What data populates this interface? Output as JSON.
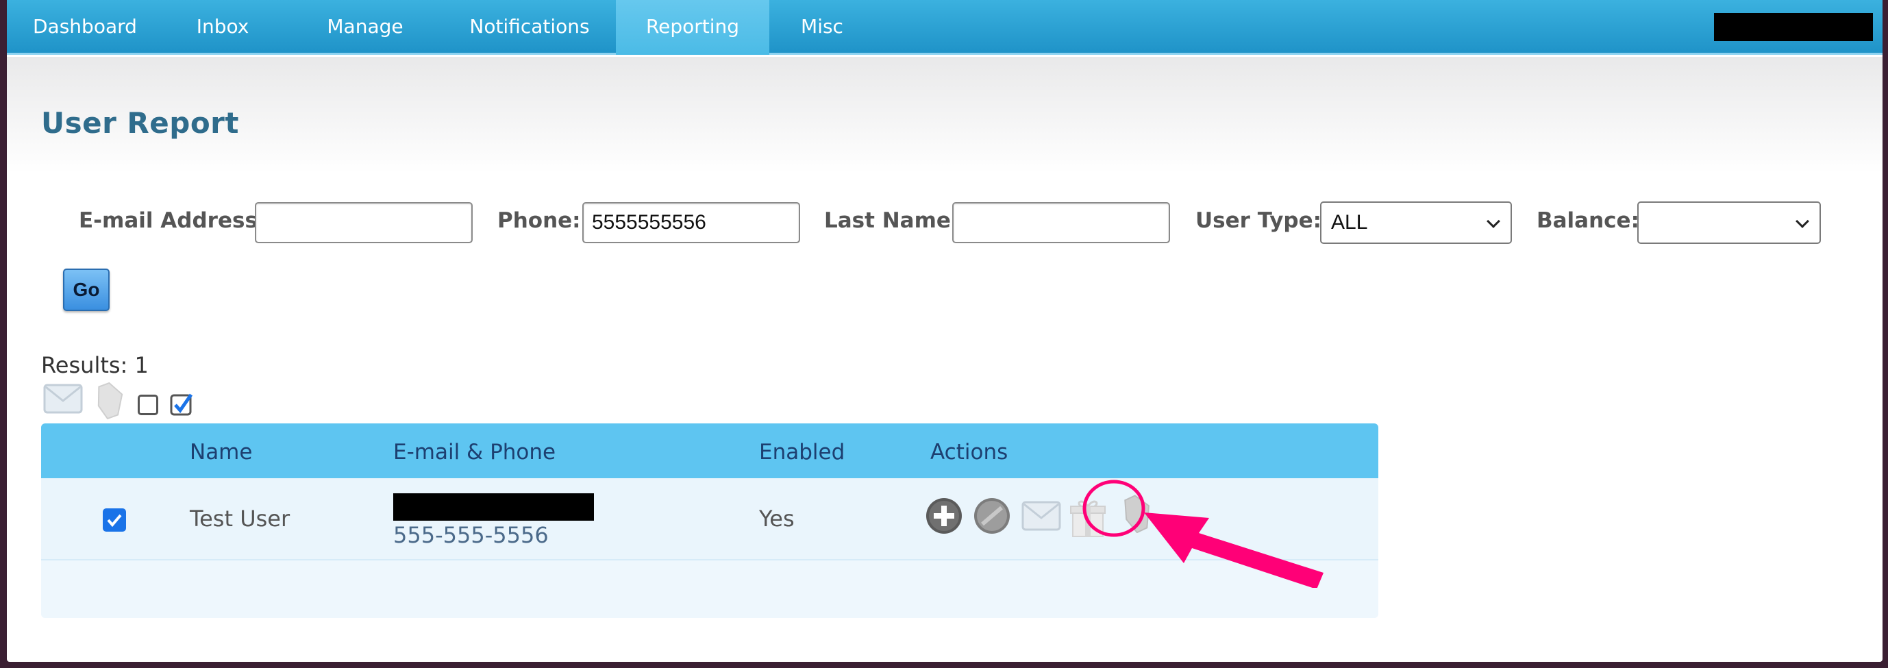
{
  "nav": {
    "items": [
      {
        "label": "Dashboard"
      },
      {
        "label": "Inbox"
      },
      {
        "label": "Manage"
      },
      {
        "label": "Notifications"
      },
      {
        "label": "Reporting"
      },
      {
        "label": "Misc"
      }
    ],
    "active": "Reporting"
  },
  "page": {
    "title": "User Report"
  },
  "filters": {
    "email_label": "E-mail Address:",
    "email_value": "",
    "phone_label": "Phone:",
    "phone_value": "5555555556",
    "lastname_label": "Last Name:",
    "lastname_value": "",
    "usertype_label": "User Type:",
    "usertype_value": "ALL",
    "balance_label": "Balance:",
    "balance_value": "",
    "go_label": "Go"
  },
  "results": {
    "label": "Results: 1"
  },
  "table": {
    "headers": {
      "name": "Name",
      "email_phone": "E-mail & Phone",
      "enabled": "Enabled",
      "actions": "Actions"
    },
    "rows": [
      {
        "name": "Test User",
        "phone": "555-555-5556",
        "enabled": "Yes",
        "checked": true
      }
    ]
  },
  "icons": {
    "bulk": [
      "mail-icon",
      "tag-icon",
      "checkbox-empty-icon",
      "checkbox-checked-icon"
    ],
    "actions": [
      "add-icon",
      "disable-icon",
      "mail-icon",
      "gift-icon",
      "tag-icon"
    ]
  },
  "colors": {
    "nav_bg": "#2aa3d6",
    "title": "#2f6c8c",
    "table_header": "#5ec5f1",
    "annotation": "#ff0077"
  }
}
